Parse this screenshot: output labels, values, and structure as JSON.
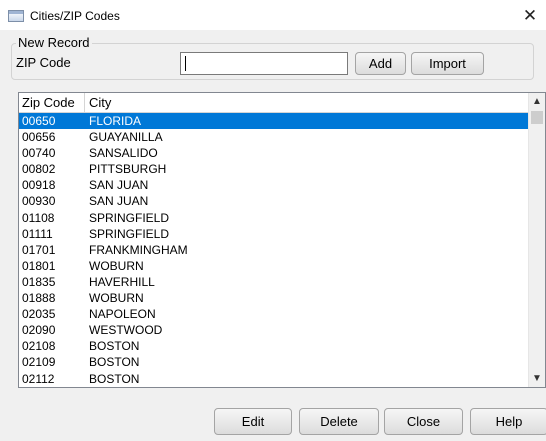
{
  "window": {
    "title": "Cities/ZIP Codes",
    "close_glyph": "✕"
  },
  "new_record": {
    "legend": "New Record",
    "zip_label": "ZIP Code",
    "zip_value": "",
    "add_label": "Add",
    "import_label": "Import"
  },
  "list": {
    "columns": [
      "Zip Code",
      "City"
    ],
    "selected_index": 0,
    "rows": [
      {
        "zip": "00650",
        "city": "FLORIDA"
      },
      {
        "zip": "00656",
        "city": "GUAYANILLA"
      },
      {
        "zip": "00740",
        "city": "SANSALIDO"
      },
      {
        "zip": "00802",
        "city": "PITTSBURGH"
      },
      {
        "zip": "00918",
        "city": "SAN JUAN"
      },
      {
        "zip": "00930",
        "city": "SAN JUAN"
      },
      {
        "zip": "01108",
        "city": "SPRINGFIELD"
      },
      {
        "zip": "01111",
        "city": "SPRINGFIELD"
      },
      {
        "zip": "01701",
        "city": "FRANKMINGHAM"
      },
      {
        "zip": "01801",
        "city": "WOBURN"
      },
      {
        "zip": "01835",
        "city": "HAVERHILL"
      },
      {
        "zip": "01888",
        "city": "WOBURN"
      },
      {
        "zip": "02035",
        "city": "NAPOLEON"
      },
      {
        "zip": "02090",
        "city": "WESTWOOD"
      },
      {
        "zip": "02108",
        "city": "BOSTON"
      },
      {
        "zip": "02109",
        "city": "BOSTON"
      },
      {
        "zip": "02112",
        "city": "BOSTON"
      }
    ]
  },
  "buttons": {
    "edit": "Edit",
    "delete": "Delete",
    "close": "Close",
    "help": "Help"
  },
  "colors": {
    "selection": "#0078d7",
    "dialog_bg": "#f0f0f0"
  },
  "icons": {
    "window": "window-app-icon",
    "close": "close-icon",
    "scroll_up": "chevron-up-icon",
    "scroll_down": "chevron-down-icon"
  }
}
